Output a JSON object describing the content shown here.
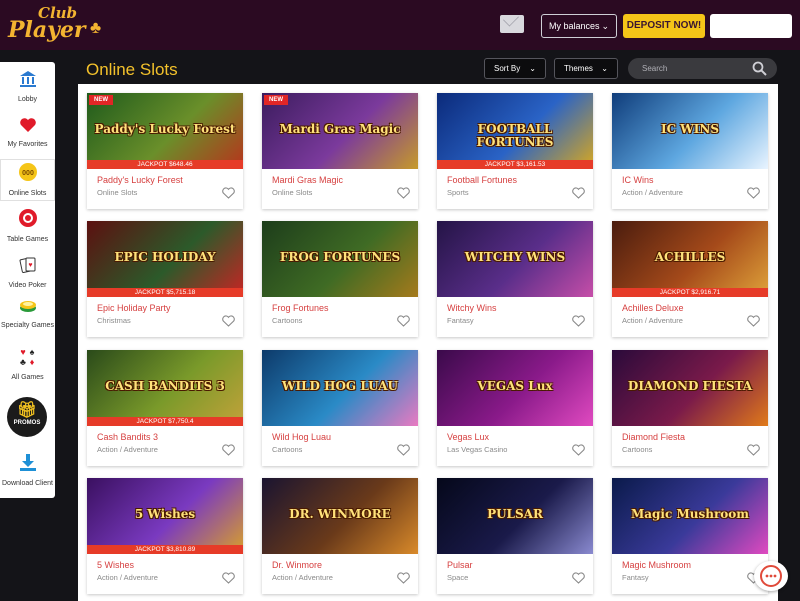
{
  "brand": {
    "club": "Club",
    "player": "Player"
  },
  "header": {
    "balances_label": "My balances",
    "deposit_label": "DEPOSIT NOW!",
    "input_value": ""
  },
  "sidebar": {
    "items": [
      {
        "label": "Lobby",
        "icon": "bank-icon"
      },
      {
        "label": "My Favorites",
        "icon": "heart-icon"
      },
      {
        "label": "Online Slots",
        "icon": "slot-coin-icon"
      },
      {
        "label": "Table Games",
        "icon": "poker-chip-icon"
      },
      {
        "label": "Video Poker",
        "icon": "cards-icon"
      },
      {
        "label": "Specialty Games",
        "icon": "specialty-icon"
      },
      {
        "label": "All Games",
        "icon": "suits-icon"
      },
      {
        "label": "PROMOS",
        "icon": "gift-icon"
      },
      {
        "label": "Download Client",
        "icon": "download-icon"
      }
    ]
  },
  "page": {
    "title": "Online Slots",
    "sort_label": "Sort By",
    "themes_label": "Themes",
    "search_placeholder": "Search"
  },
  "colors": {
    "header_bg": "#2b0a22",
    "accent_gold": "#f3c12b",
    "deposit_yellow": "#f5c518",
    "game_name_red": "#d64040",
    "jackpot_red": "#e63b28"
  },
  "games": [
    {
      "name": "Paddy's Lucky Forest",
      "category": "Online Slots",
      "art_title": "Paddy's Lucky Forest",
      "badge": "NEW",
      "jackpot": "JACKPOT $648.46",
      "bg": [
        "#1f5a1c",
        "#6a8f2a",
        "#b8331c"
      ]
    },
    {
      "name": "Mardi Gras Magic",
      "category": "Online Slots",
      "art_title": "Mardi Gras Magic",
      "badge": "NEW",
      "jackpot": "",
      "bg": [
        "#3b1c5e",
        "#7b3a9c",
        "#c69a2a"
      ]
    },
    {
      "name": "Football Fortunes",
      "category": "Sports",
      "art_title": "FOOTBALL FORTUNES",
      "badge": "",
      "jackpot": "JACKPOT $3,161.53",
      "bg": [
        "#0b2a7a",
        "#2a63c6",
        "#d9a81f"
      ]
    },
    {
      "name": "IC Wins",
      "category": "Action / Adventure",
      "art_title": "IC WINS",
      "badge": "",
      "jackpot": "",
      "bg": [
        "#0f3c7a",
        "#5ea7e0",
        "#e9f4ff"
      ]
    },
    {
      "name": "Epic Holiday Party",
      "category": "Christmas",
      "art_title": "EPIC HOLIDAY",
      "badge": "",
      "jackpot": "JACKPOT $5,715.18",
      "bg": [
        "#5c1010",
        "#2c5a2a",
        "#c92424"
      ]
    },
    {
      "name": "Frog Fortunes",
      "category": "Cartoons",
      "art_title": "FROG FORTUNES",
      "badge": "",
      "jackpot": "",
      "bg": [
        "#1d3d1b",
        "#3f6b24",
        "#a57a1c"
      ]
    },
    {
      "name": "Witchy Wins",
      "category": "Fantasy",
      "art_title": "WITCHY WINS",
      "badge": "",
      "jackpot": "",
      "bg": [
        "#241446",
        "#5a2e8a",
        "#c64ea8"
      ]
    },
    {
      "name": "Achilles Deluxe",
      "category": "Action / Adventure",
      "art_title": "ACHILLES",
      "badge": "",
      "jackpot": "JACKPOT $2,916.71",
      "bg": [
        "#4a1c0e",
        "#a54a1a",
        "#e0a33a"
      ]
    },
    {
      "name": "Cash Bandits 3",
      "category": "Action / Adventure",
      "art_title": "CASH BANDITS 3",
      "badge": "",
      "jackpot": "JACKPOT $7,750.4",
      "bg": [
        "#2a4a1a",
        "#7a9a2a",
        "#c3a23a"
      ]
    },
    {
      "name": "Wild Hog Luau",
      "category": "Cartoons",
      "art_title": "WILD HOG LUAU",
      "badge": "",
      "jackpot": "",
      "bg": [
        "#0d3a6a",
        "#2a8ac6",
        "#e97ac1"
      ]
    },
    {
      "name": "Vegas Lux",
      "category": "Las Vegas Casino",
      "art_title": "VEGAS Lux",
      "badge": "",
      "jackpot": "",
      "bg": [
        "#3a0a4a",
        "#8a1a8a",
        "#e04ac0"
      ]
    },
    {
      "name": "Diamond Fiesta",
      "category": "Cartoons",
      "art_title": "DIAMOND FIESTA",
      "badge": "",
      "jackpot": "",
      "bg": [
        "#2a0a3a",
        "#7a1a4a",
        "#e07a1a"
      ]
    },
    {
      "name": "5 Wishes",
      "category": "Action / Adventure",
      "art_title": "5 Wishes",
      "badge": "",
      "jackpot": "JACKPOT $3,810.89",
      "bg": [
        "#3a1060",
        "#7a3ac0",
        "#d9a02a"
      ]
    },
    {
      "name": "Dr. Winmore",
      "category": "Action / Adventure",
      "art_title": "DR. WINMORE",
      "badge": "",
      "jackpot": "",
      "bg": [
        "#1a1430",
        "#6a3a1a",
        "#d98a2a"
      ]
    },
    {
      "name": "Pulsar",
      "category": "Space",
      "art_title": "PULSAR",
      "badge": "",
      "jackpot": "",
      "bg": [
        "#05081a",
        "#1a1a4a",
        "#8a8ad0"
      ]
    },
    {
      "name": "Magic Mushroom",
      "category": "Fantasy",
      "art_title": "Magic Mushroom",
      "badge": "",
      "jackpot": "",
      "bg": [
        "#0a1a4a",
        "#3a3a9a",
        "#e04ac0"
      ]
    }
  ]
}
